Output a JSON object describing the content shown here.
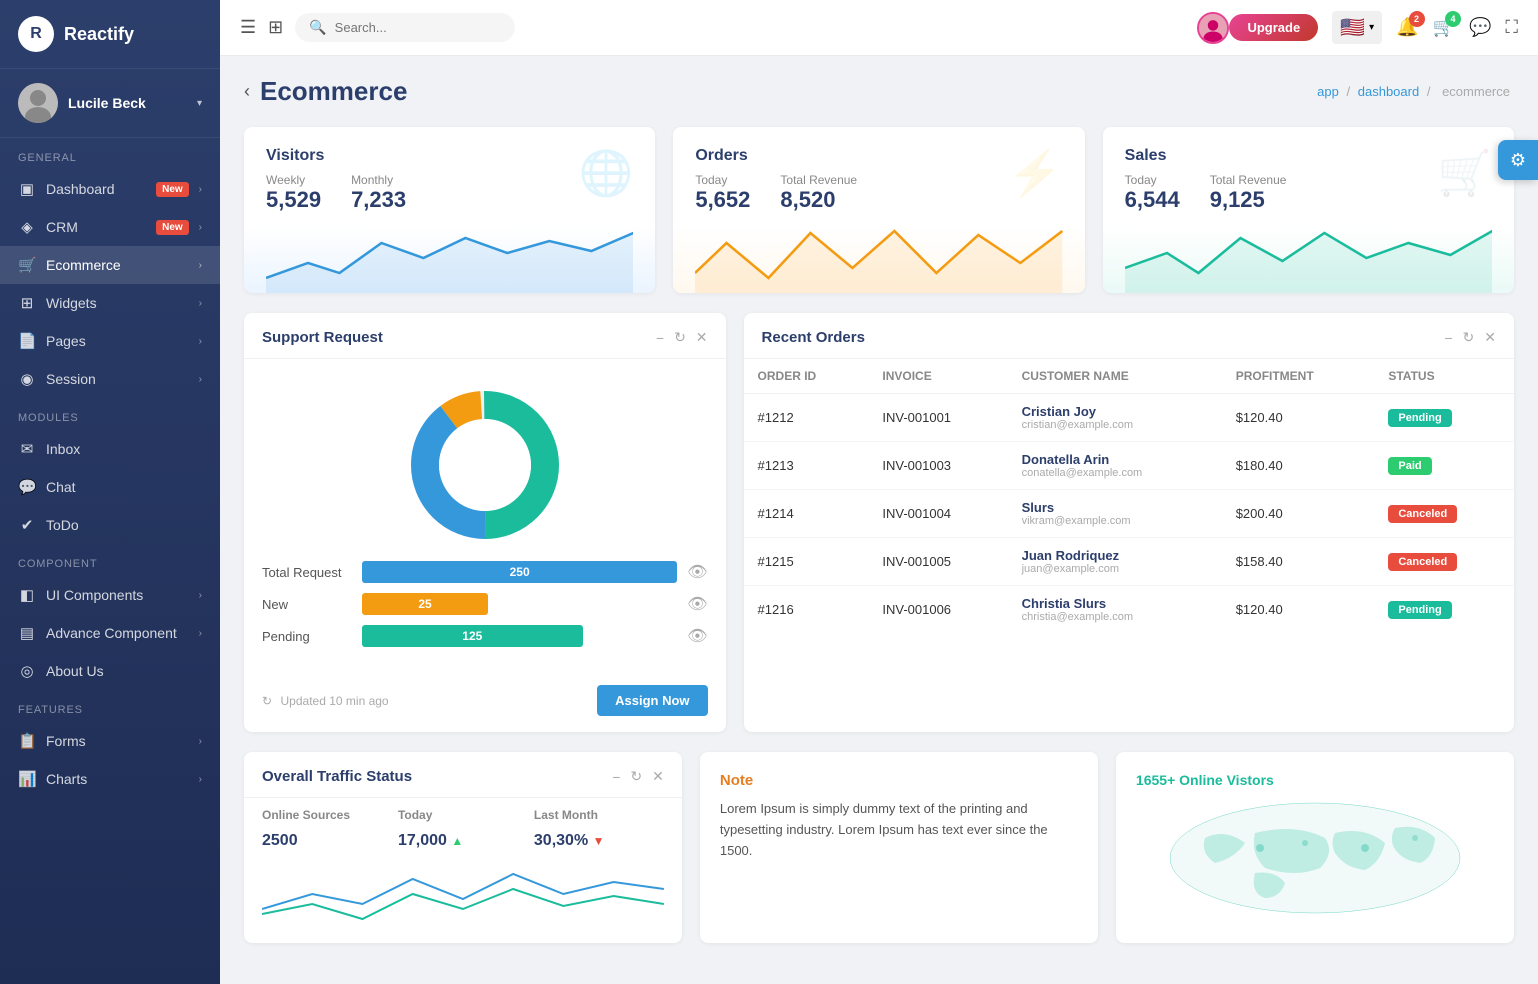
{
  "app": {
    "name": "Reactify",
    "logo_letter": "R"
  },
  "user": {
    "name": "Lucile Beck"
  },
  "sidebar": {
    "sections": [
      {
        "label": "General",
        "items": [
          {
            "id": "dashboard",
            "label": "Dashboard",
            "icon": "▣",
            "badge": "New",
            "badge_color": "red",
            "has_arrow": true
          },
          {
            "id": "crm",
            "label": "CRM",
            "icon": "◈",
            "badge": "New",
            "badge_color": "red",
            "has_arrow": true
          },
          {
            "id": "ecommerce",
            "label": "Ecommerce",
            "icon": "🛒",
            "badge": null,
            "has_arrow": true,
            "active": true
          },
          {
            "id": "widgets",
            "label": "Widgets",
            "icon": "⊞",
            "badge": null,
            "has_arrow": true
          },
          {
            "id": "pages",
            "label": "Pages",
            "icon": "📄",
            "badge": null,
            "has_arrow": true
          },
          {
            "id": "session",
            "label": "Session",
            "icon": "◉",
            "badge": null,
            "has_arrow": true
          }
        ]
      },
      {
        "label": "Modules",
        "items": [
          {
            "id": "inbox",
            "label": "Inbox",
            "icon": "✉",
            "badge": null,
            "has_arrow": false
          },
          {
            "id": "chat",
            "label": "Chat",
            "icon": "💬",
            "badge": null,
            "has_arrow": false
          },
          {
            "id": "todo",
            "label": "ToDo",
            "icon": "✔",
            "badge": null,
            "has_arrow": false
          }
        ]
      },
      {
        "label": "Component",
        "items": [
          {
            "id": "ui-components",
            "label": "UI Components",
            "icon": "◧",
            "badge": null,
            "has_arrow": true
          },
          {
            "id": "advance-component",
            "label": "Advance Component",
            "icon": "▤",
            "badge": null,
            "has_arrow": true
          },
          {
            "id": "about-us",
            "label": "About Us",
            "icon": "◎",
            "badge": null,
            "has_arrow": false
          }
        ]
      },
      {
        "label": "Features",
        "items": [
          {
            "id": "forms",
            "label": "Forms",
            "icon": "📋",
            "badge": null,
            "has_arrow": true
          },
          {
            "id": "charts",
            "label": "Charts",
            "icon": "📊",
            "badge": null,
            "has_arrow": true
          }
        ]
      }
    ]
  },
  "topbar": {
    "search_placeholder": "Search...",
    "upgrade_label": "Upgrade",
    "notification_count": "2",
    "cart_count": "4",
    "flag_emoji": "🇺🇸"
  },
  "page": {
    "title": "Ecommerce",
    "breadcrumb": [
      "app",
      "dashboard",
      "ecommerce"
    ]
  },
  "stats": [
    {
      "id": "visitors",
      "title": "Visitors",
      "icon": "🌐",
      "label1": "Weekly",
      "value1": "5,529",
      "label2": "Monthly",
      "value2": "7,233",
      "color": "#3498db",
      "bg": "#eaf4ff"
    },
    {
      "id": "orders",
      "title": "Orders",
      "icon": "⚡",
      "label1": "Today",
      "value1": "5,652",
      "label2": "Total Revenue",
      "value2": "8,520",
      "color": "#f39c12",
      "bg": "#fff8ee"
    },
    {
      "id": "sales",
      "title": "Sales",
      "icon": "🛒",
      "label1": "Today",
      "value1": "6,544",
      "label2": "Total Revenue",
      "value2": "9,125",
      "color": "#1abc9c",
      "bg": "#eafaf6"
    }
  ],
  "support": {
    "title": "Support Request",
    "updated": "Updated 10 min ago",
    "assign_btn": "Assign Now",
    "donut": {
      "total": 250,
      "new": 25,
      "pending": 125
    },
    "rows": [
      {
        "label": "Total Request",
        "value": 250,
        "color": "#3498db"
      },
      {
        "label": "New",
        "value": 25,
        "color": "#f39c12"
      },
      {
        "label": "Pending",
        "value": 125,
        "color": "#1abc9c"
      }
    ]
  },
  "recent_orders": {
    "title": "Recent Orders",
    "columns": [
      "Order ID",
      "Invoice",
      "Customer Name",
      "Profitment",
      "Status"
    ],
    "rows": [
      {
        "id": "#1212",
        "invoice": "INV-001001",
        "name": "Cristian Joy",
        "email": "cristian@example.com",
        "profit": "$120.40",
        "status": "Pending",
        "status_type": "pending"
      },
      {
        "id": "#1213",
        "invoice": "INV-001003",
        "name": "Donatella Arin",
        "email": "conatella@example.com",
        "profit": "$180.40",
        "status": "Paid",
        "status_type": "paid"
      },
      {
        "id": "#1214",
        "invoice": "INV-001004",
        "name": "Slurs",
        "email": "vikram@example.com",
        "profit": "$200.40",
        "status": "Canceled",
        "status_type": "canceled"
      },
      {
        "id": "#1215",
        "invoice": "INV-001005",
        "name": "Juan Rodriquez",
        "email": "juan@example.com",
        "profit": "$158.40",
        "status": "Canceled",
        "status_type": "canceled"
      },
      {
        "id": "#1216",
        "invoice": "INV-001006",
        "name": "Christia Slurs",
        "email": "christia@example.com",
        "profit": "$120.40",
        "status": "Pending",
        "status_type": "pending"
      }
    ]
  },
  "traffic": {
    "title": "Overall Traffic Status",
    "col1": "Online Sources",
    "col2": "Today",
    "col3": "Last Month",
    "row1_source": "2500",
    "row1_today": "17,000",
    "row1_today_dir": "up",
    "row1_last": "30,30%",
    "row1_last_dir": "down"
  },
  "note": {
    "title": "Note",
    "text": "Lorem Ipsum is simply dummy text of the printing and typesetting industry. Lorem Ipsum has text ever since the 1500."
  },
  "online_visitors": {
    "prefix": "1655+",
    "label": "Online Vistors"
  }
}
